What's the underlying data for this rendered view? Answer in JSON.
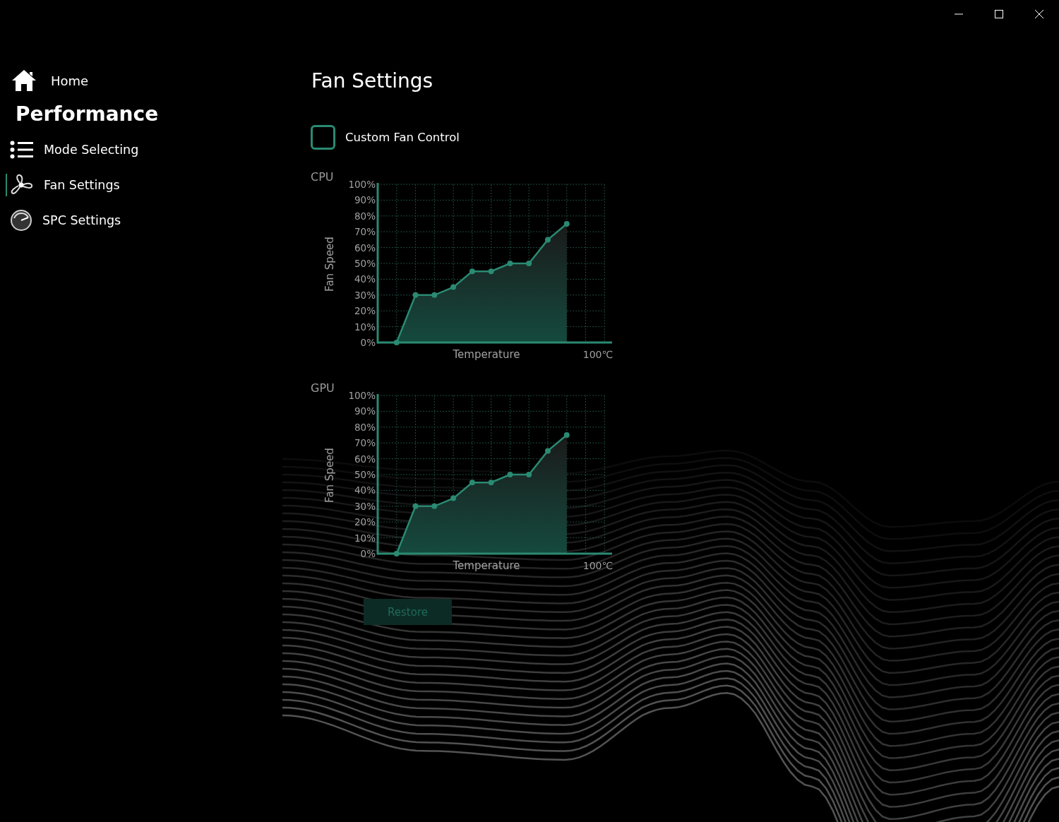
{
  "sidebar": {
    "home": {
      "label": "Home"
    },
    "section_title": "Performance",
    "items": [
      {
        "label": "Mode Selecting",
        "kind": "list",
        "selected": false
      },
      {
        "label": "Fan Settings",
        "kind": "fan",
        "selected": true
      },
      {
        "label": "SPC Settings",
        "kind": "gauge",
        "selected": false
      }
    ]
  },
  "main": {
    "title": "Fan Settings",
    "custom_fan_control": {
      "label": "Custom Fan Control",
      "checked": false
    },
    "charts": [
      {
        "chart_data": {
          "type": "area",
          "title": "CPU",
          "xlabel": "Temperature",
          "ylabel": "Fan Speed",
          "grid": true,
          "series": [
            {
              "color": "#2a8a72",
              "values": [
                0,
                30,
                30,
                35,
                45,
                45,
                50,
                50,
                65,
                75
              ]
            }
          ],
          "ylim": [
            0,
            100
          ],
          "annotations": [
            {
              "text": "100℃"
            }
          ],
          "yticks": [
            {
              "value": 0,
              "label": "0%"
            },
            {
              "value": 10,
              "label": "10%"
            },
            {
              "value": 20,
              "label": "20%"
            },
            {
              "value": 30,
              "label": "30%"
            },
            {
              "value": 40,
              "label": "40%"
            },
            {
              "value": 50,
              "label": "50%"
            },
            {
              "value": 60,
              "label": "60%"
            },
            {
              "value": 70,
              "label": "70%"
            },
            {
              "value": 80,
              "label": "80%"
            },
            {
              "value": 90,
              "label": "90%"
            },
            {
              "value": 100,
              "label": "100%"
            }
          ]
        }
      },
      {
        "chart_data": {
          "type": "area",
          "title": "GPU",
          "xlabel": "Temperature",
          "ylabel": "Fan Speed",
          "grid": true,
          "series": [
            {
              "color": "#2a8a72",
              "values": [
                0,
                30,
                30,
                35,
                45,
                45,
                50,
                50,
                65,
                75
              ]
            }
          ],
          "ylim": [
            0,
            100
          ],
          "annotations": [
            {
              "text": "100℃"
            }
          ],
          "yticks": [
            {
              "value": 0,
              "label": "0%"
            },
            {
              "value": 10,
              "label": "10%"
            },
            {
              "value": 20,
              "label": "20%"
            },
            {
              "value": 30,
              "label": "30%"
            },
            {
              "value": 40,
              "label": "40%"
            },
            {
              "value": 50,
              "label": "50%"
            },
            {
              "value": 60,
              "label": "60%"
            },
            {
              "value": 70,
              "label": "70%"
            },
            {
              "value": 80,
              "label": "80%"
            },
            {
              "value": 90,
              "label": "90%"
            },
            {
              "value": 100,
              "label": "100%"
            }
          ]
        }
      }
    ],
    "restore_button": {
      "label": "Restore",
      "disabled": true
    }
  }
}
